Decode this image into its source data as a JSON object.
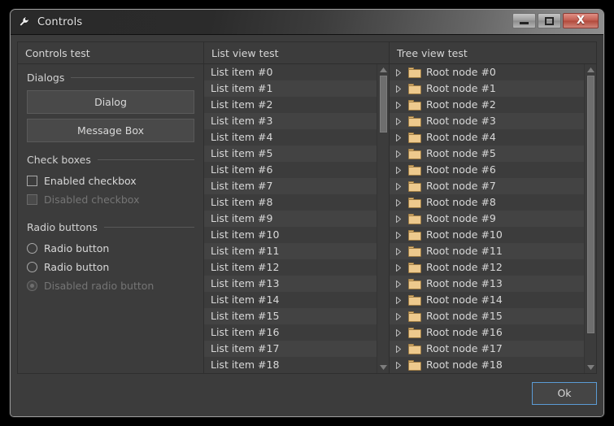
{
  "window": {
    "title": "Controls",
    "icon": "wrench-icon",
    "caption_buttons": [
      {
        "name": "minimize",
        "glyph": "minimize-icon",
        "label": ""
      },
      {
        "name": "maximize",
        "glyph": "maximize-icon",
        "label": ""
      },
      {
        "name": "close",
        "glyph": "close-icon",
        "label": "X"
      }
    ]
  },
  "colors": {
    "window_bg": "#3c3c3c",
    "row_alt": "#434343",
    "text": "#d8d8d8",
    "text_disabled": "#757575",
    "folder": "#edc98d",
    "focus_border": "#5b9bd5",
    "close_button": "#c25d50"
  },
  "left_panel": {
    "title": "Controls test",
    "sections": [
      {
        "label": "Dialogs"
      },
      {
        "label": "Check boxes"
      },
      {
        "label": "Radio buttons"
      }
    ],
    "buttons": [
      {
        "label": "Dialog"
      },
      {
        "label": "Message Box"
      }
    ],
    "checkboxes": [
      {
        "label": "Enabled checkbox",
        "checked": false,
        "disabled": false
      },
      {
        "label": "Disabled checkbox",
        "checked": false,
        "disabled": true
      }
    ],
    "radios": [
      {
        "label": "Radio button",
        "selected": false,
        "disabled": false
      },
      {
        "label": "Radio button",
        "selected": false,
        "disabled": false
      },
      {
        "label": "Disabled radio button",
        "selected": true,
        "disabled": true
      }
    ]
  },
  "list_panel": {
    "title": "List view test",
    "items": [
      "List item #0",
      "List item #1",
      "List item #2",
      "List item #3",
      "List item #4",
      "List item #5",
      "List item #6",
      "List item #7",
      "List item #8",
      "List item #9",
      "List item #10",
      "List item #11",
      "List item #12",
      "List item #13",
      "List item #14",
      "List item #15",
      "List item #16",
      "List item #17",
      "List item #18"
    ],
    "scrollbar": {
      "thumb_top_pct": 0,
      "thumb_height_pct": 20
    }
  },
  "tree_panel": {
    "title": "Tree view test",
    "nodes": [
      "Root node #0",
      "Root node #1",
      "Root node #2",
      "Root node #3",
      "Root node #4",
      "Root node #5",
      "Root node #6",
      "Root node #7",
      "Root node #8",
      "Root node #9",
      "Root node #10",
      "Root node #11",
      "Root node #12",
      "Root node #13",
      "Root node #14",
      "Root node #15",
      "Root node #16",
      "Root node #17",
      "Root node #18"
    ],
    "scrollbar": {
      "thumb_top_pct": 0,
      "thumb_height_pct": 90
    }
  },
  "footer": {
    "ok_label": "Ok"
  }
}
